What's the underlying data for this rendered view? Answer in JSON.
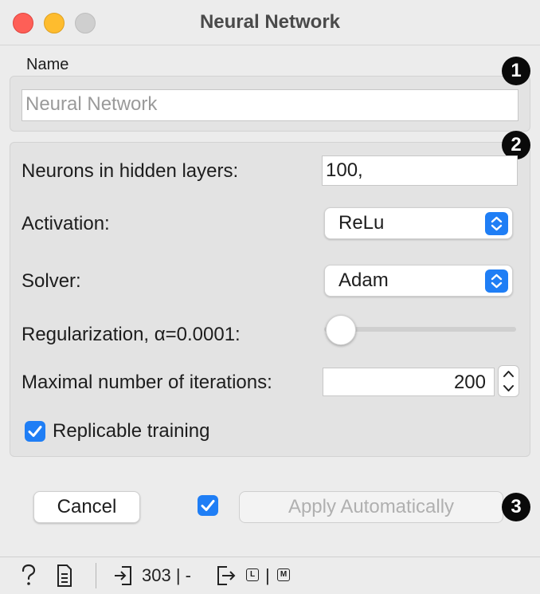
{
  "window": {
    "title": "Neural Network"
  },
  "name_section": {
    "label": "Name",
    "input_placeholder": "Neural Network"
  },
  "params": {
    "neurons_label": "Neurons in hidden layers:",
    "neurons_value": "100,",
    "activation_label": "Activation:",
    "activation_value": "ReLu",
    "solver_label": "Solver:",
    "solver_value": "Adam",
    "regularization_label": "Regularization, α=0.0001:",
    "regularization_slider_fraction": 0.0,
    "iterations_label": "Maximal number of iterations:",
    "iterations_value": "200",
    "replicable_label": "Replicable training",
    "replicable_checked": true
  },
  "footer": {
    "cancel_label": "Cancel",
    "apply_label": "Apply Automatically",
    "apply_auto_checked": true
  },
  "badges": [
    "1",
    "2",
    "3"
  ],
  "statusbar": {
    "input_count": "303 | -",
    "output_box1": "L",
    "output_sep": "|",
    "output_box2": "M"
  },
  "colors": {
    "accent": "#1f7ef5",
    "close": "#fe5f57",
    "minimize": "#febc2e",
    "maximize": "#cfcfcf"
  },
  "icons": [
    "help-icon",
    "report-icon",
    "input-icon",
    "output-icon",
    "chevron-updown-icon",
    "checkmark-icon"
  ]
}
